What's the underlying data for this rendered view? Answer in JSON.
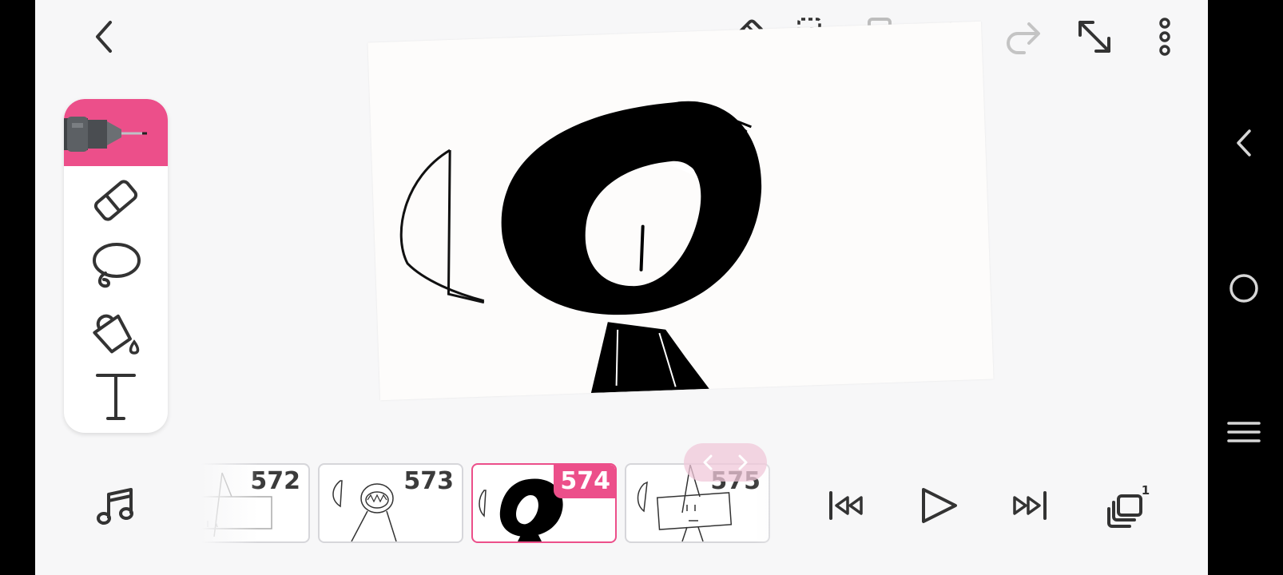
{
  "toolbar": {
    "back_icon": "chevron-left",
    "top_icons": [
      "ruler-icon",
      "selection-copy-icon",
      "duplicate-icon",
      "undo-icon",
      "redo-icon",
      "expand-icon",
      "more-vertical-icon"
    ]
  },
  "tools": {
    "active": "pen",
    "items": [
      "pen",
      "eraser",
      "lasso",
      "fill-bucket",
      "text"
    ],
    "accent_color": "#ec4f8a"
  },
  "filmstrip": {
    "frames": [
      {
        "number": "572",
        "selected": false
      },
      {
        "number": "573",
        "selected": false
      },
      {
        "number": "574",
        "selected": true
      },
      {
        "number": "575",
        "selected": false
      }
    ]
  },
  "playback": {
    "icons": [
      "music-note-icon",
      "skip-to-start-icon",
      "play-icon",
      "skip-to-end-icon",
      "layers-icon"
    ],
    "layers_badge": "1"
  },
  "system_nav": {
    "icons": [
      "back-icon",
      "home-icon",
      "recents-icon"
    ]
  }
}
